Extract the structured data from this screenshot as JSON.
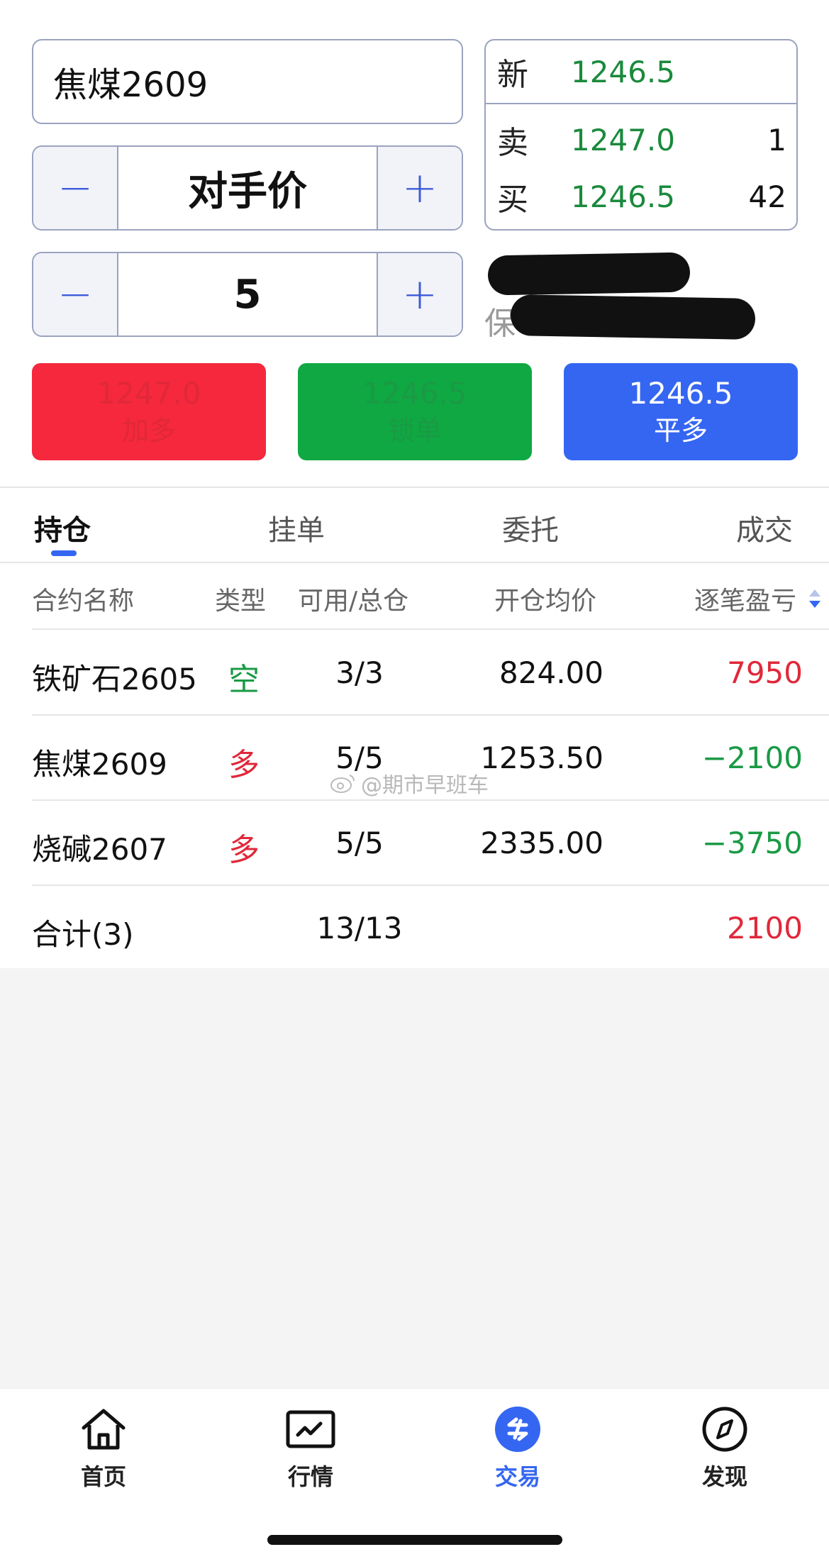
{
  "colors": {
    "accent": "#3566f2",
    "buy_red": "#f5283d",
    "lock_green": "#0fa842",
    "close_blue": "#3566f2",
    "profit_red": "#e0283a",
    "loss_green": "#1a9a45"
  },
  "order": {
    "contract": "焦煤2609",
    "price_mode": "对手价",
    "quantity": "5",
    "minus_glyph": "−",
    "plus_glyph": "+"
  },
  "quote": {
    "last_label": "新",
    "last_price": "1246.5",
    "ask_label": "卖",
    "ask_price": "1247.0",
    "ask_qty": "1",
    "bid_label": "买",
    "bid_price": "1246.5",
    "bid_qty": "42",
    "margin_label_char": "保"
  },
  "actions": [
    {
      "price": "1247.0",
      "label": "加多"
    },
    {
      "price": "1246.5",
      "label": "锁单"
    },
    {
      "price": "1246.5",
      "label": "平多"
    }
  ],
  "tabs": [
    "持仓",
    "挂单",
    "委托",
    "成交"
  ],
  "table": {
    "headers": [
      "合约名称",
      "类型",
      "可用/总仓",
      "开仓均价",
      "逐笔盈亏"
    ],
    "rows": [
      {
        "name": "铁矿石2605",
        "type": "空",
        "volume": "3/3",
        "price": "824.00",
        "pnl": "7950"
      },
      {
        "name": "焦煤2609",
        "type": "多",
        "volume": "5/5",
        "price": "1253.50",
        "pnl": "−2100"
      },
      {
        "name": "烧碱2607",
        "type": "多",
        "volume": "5/5",
        "price": "2335.00",
        "pnl": "−3750"
      }
    ],
    "total": {
      "label": "合计(3)",
      "volume": "13/13",
      "pnl": "2100"
    }
  },
  "watermark": "@期市早班车",
  "nav": [
    {
      "label": "首页",
      "icon": "home-icon"
    },
    {
      "label": "行情",
      "icon": "chart-icon"
    },
    {
      "label": "交易",
      "icon": "trade-icon"
    },
    {
      "label": "发现",
      "icon": "compass-icon"
    }
  ]
}
